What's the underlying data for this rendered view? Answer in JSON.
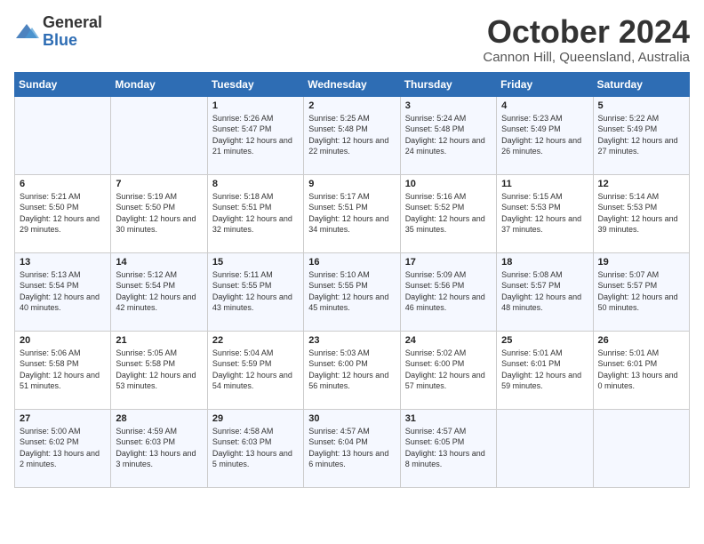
{
  "logo": {
    "general": "General",
    "blue": "Blue"
  },
  "header": {
    "month": "October 2024",
    "location": "Cannon Hill, Queensland, Australia"
  },
  "weekdays": [
    "Sunday",
    "Monday",
    "Tuesday",
    "Wednesday",
    "Thursday",
    "Friday",
    "Saturday"
  ],
  "weeks": [
    [
      {
        "day": "",
        "content": ""
      },
      {
        "day": "",
        "content": ""
      },
      {
        "day": "1",
        "content": "Sunrise: 5:26 AM\nSunset: 5:47 PM\nDaylight: 12 hours and 21 minutes."
      },
      {
        "day": "2",
        "content": "Sunrise: 5:25 AM\nSunset: 5:48 PM\nDaylight: 12 hours and 22 minutes."
      },
      {
        "day": "3",
        "content": "Sunrise: 5:24 AM\nSunset: 5:48 PM\nDaylight: 12 hours and 24 minutes."
      },
      {
        "day": "4",
        "content": "Sunrise: 5:23 AM\nSunset: 5:49 PM\nDaylight: 12 hours and 26 minutes."
      },
      {
        "day": "5",
        "content": "Sunrise: 5:22 AM\nSunset: 5:49 PM\nDaylight: 12 hours and 27 minutes."
      }
    ],
    [
      {
        "day": "6",
        "content": "Sunrise: 5:21 AM\nSunset: 5:50 PM\nDaylight: 12 hours and 29 minutes."
      },
      {
        "day": "7",
        "content": "Sunrise: 5:19 AM\nSunset: 5:50 PM\nDaylight: 12 hours and 30 minutes."
      },
      {
        "day": "8",
        "content": "Sunrise: 5:18 AM\nSunset: 5:51 PM\nDaylight: 12 hours and 32 minutes."
      },
      {
        "day": "9",
        "content": "Sunrise: 5:17 AM\nSunset: 5:51 PM\nDaylight: 12 hours and 34 minutes."
      },
      {
        "day": "10",
        "content": "Sunrise: 5:16 AM\nSunset: 5:52 PM\nDaylight: 12 hours and 35 minutes."
      },
      {
        "day": "11",
        "content": "Sunrise: 5:15 AM\nSunset: 5:53 PM\nDaylight: 12 hours and 37 minutes."
      },
      {
        "day": "12",
        "content": "Sunrise: 5:14 AM\nSunset: 5:53 PM\nDaylight: 12 hours and 39 minutes."
      }
    ],
    [
      {
        "day": "13",
        "content": "Sunrise: 5:13 AM\nSunset: 5:54 PM\nDaylight: 12 hours and 40 minutes."
      },
      {
        "day": "14",
        "content": "Sunrise: 5:12 AM\nSunset: 5:54 PM\nDaylight: 12 hours and 42 minutes."
      },
      {
        "day": "15",
        "content": "Sunrise: 5:11 AM\nSunset: 5:55 PM\nDaylight: 12 hours and 43 minutes."
      },
      {
        "day": "16",
        "content": "Sunrise: 5:10 AM\nSunset: 5:55 PM\nDaylight: 12 hours and 45 minutes."
      },
      {
        "day": "17",
        "content": "Sunrise: 5:09 AM\nSunset: 5:56 PM\nDaylight: 12 hours and 46 minutes."
      },
      {
        "day": "18",
        "content": "Sunrise: 5:08 AM\nSunset: 5:57 PM\nDaylight: 12 hours and 48 minutes."
      },
      {
        "day": "19",
        "content": "Sunrise: 5:07 AM\nSunset: 5:57 PM\nDaylight: 12 hours and 50 minutes."
      }
    ],
    [
      {
        "day": "20",
        "content": "Sunrise: 5:06 AM\nSunset: 5:58 PM\nDaylight: 12 hours and 51 minutes."
      },
      {
        "day": "21",
        "content": "Sunrise: 5:05 AM\nSunset: 5:58 PM\nDaylight: 12 hours and 53 minutes."
      },
      {
        "day": "22",
        "content": "Sunrise: 5:04 AM\nSunset: 5:59 PM\nDaylight: 12 hours and 54 minutes."
      },
      {
        "day": "23",
        "content": "Sunrise: 5:03 AM\nSunset: 6:00 PM\nDaylight: 12 hours and 56 minutes."
      },
      {
        "day": "24",
        "content": "Sunrise: 5:02 AM\nSunset: 6:00 PM\nDaylight: 12 hours and 57 minutes."
      },
      {
        "day": "25",
        "content": "Sunrise: 5:01 AM\nSunset: 6:01 PM\nDaylight: 12 hours and 59 minutes."
      },
      {
        "day": "26",
        "content": "Sunrise: 5:01 AM\nSunset: 6:01 PM\nDaylight: 13 hours and 0 minutes."
      }
    ],
    [
      {
        "day": "27",
        "content": "Sunrise: 5:00 AM\nSunset: 6:02 PM\nDaylight: 13 hours and 2 minutes."
      },
      {
        "day": "28",
        "content": "Sunrise: 4:59 AM\nSunset: 6:03 PM\nDaylight: 13 hours and 3 minutes."
      },
      {
        "day": "29",
        "content": "Sunrise: 4:58 AM\nSunset: 6:03 PM\nDaylight: 13 hours and 5 minutes."
      },
      {
        "day": "30",
        "content": "Sunrise: 4:57 AM\nSunset: 6:04 PM\nDaylight: 13 hours and 6 minutes."
      },
      {
        "day": "31",
        "content": "Sunrise: 4:57 AM\nSunset: 6:05 PM\nDaylight: 13 hours and 8 minutes."
      },
      {
        "day": "",
        "content": ""
      },
      {
        "day": "",
        "content": ""
      }
    ]
  ]
}
